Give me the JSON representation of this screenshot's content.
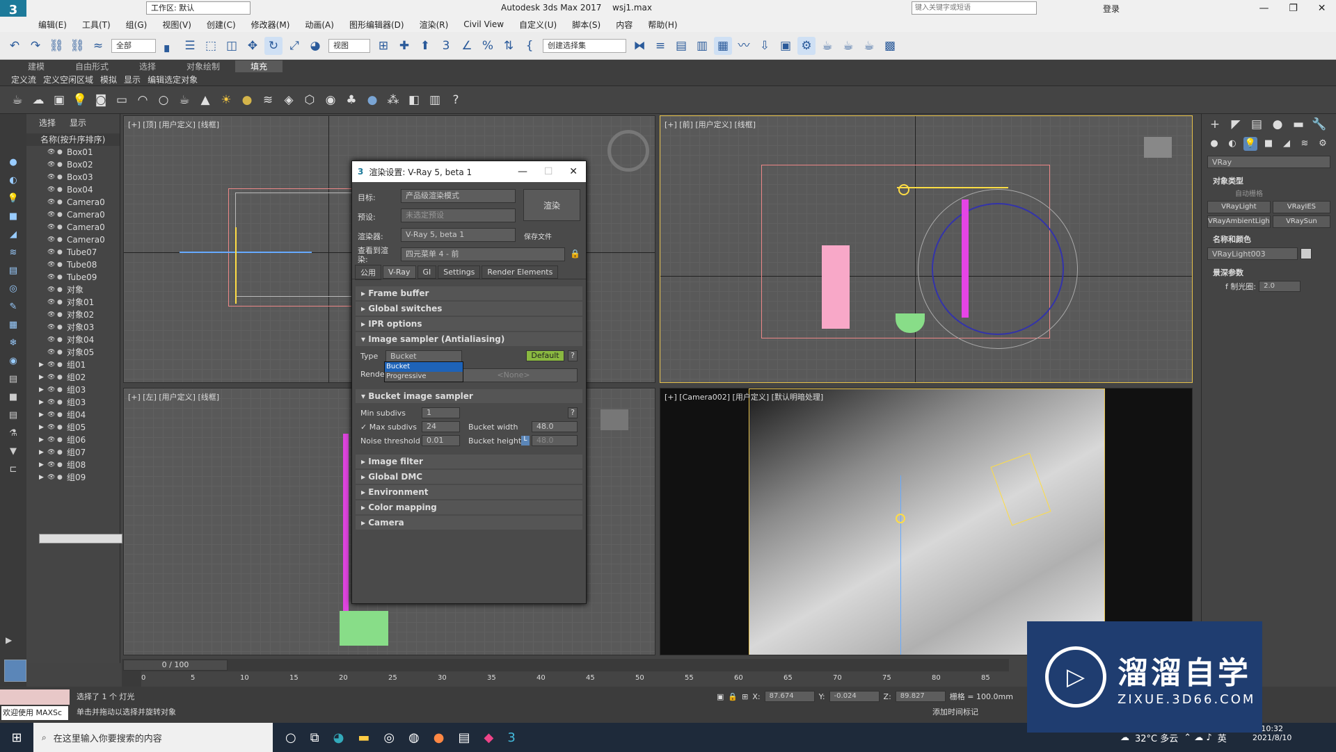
{
  "titlebar": {
    "workspace_label": "工作区: 默认",
    "app_title": "Autodesk 3ds Max 2017",
    "file_name": "wsj1.max",
    "search_placeholder": "键入关键字或短语",
    "login": "登录"
  },
  "menu": [
    "编辑(E)",
    "工具(T)",
    "组(G)",
    "视图(V)",
    "创建(C)",
    "修改器(M)",
    "动画(A)",
    "图形编辑器(D)",
    "渲染(R)",
    "Civil View",
    "自定义(U)",
    "脚本(S)",
    "内容",
    "帮助(H)"
  ],
  "toolbar": {
    "filter": "全部",
    "view": "视图",
    "selection_set": "创建选择集"
  },
  "ribbon": {
    "tabs": [
      "建模",
      "自由形式",
      "选择",
      "对象绘制",
      "填充"
    ],
    "active_tab": "填充",
    "sub": [
      "定义流",
      "定义空闲区域",
      "模拟",
      "显示",
      "编辑选定对象"
    ]
  },
  "scene": {
    "tabs": [
      "选择",
      "显示"
    ],
    "header": "名称(按升序排序)",
    "items": [
      "Box01",
      "Box02",
      "Box03",
      "Box04",
      "Camera0",
      "Camera0",
      "Camera0",
      "Camera0",
      "Tube07",
      "Tube08",
      "Tube09",
      "对象",
      "对象01",
      "对象02",
      "对象03",
      "对象04",
      "对象05",
      "组01",
      "组02",
      "组03",
      "组03",
      "组04",
      "组05",
      "组06",
      "组07",
      "组08",
      "组09"
    ]
  },
  "viewports": {
    "top": "[+] [顶] [用户定义] [线框]",
    "front": "[+] [前] [用户定义] [线框]",
    "left": "[+] [左] [用户定义] [线框]",
    "camera": "[+] [Camera002] [用户定义] [默认明暗处理]"
  },
  "dialog": {
    "title": "渲染设置: V-Ray 5, beta 1",
    "target_label": "目标:",
    "target_value": "产品级渲染模式",
    "preset_label": "预设:",
    "preset_value": "未选定预设",
    "renderer_label": "渲染器:",
    "renderer_value": "V-Ray 5, beta 1",
    "save_file": "保存文件",
    "view_label": "查看到渲染:",
    "view_value": "四元菜单 4 - 前",
    "render_button": "渲染",
    "tabs": [
      "公用",
      "V-Ray",
      "GI",
      "Settings",
      "Render Elements"
    ],
    "rollouts_top": [
      "Frame buffer",
      "Global switches",
      "IPR options",
      "Image sampler (Antialiasing)"
    ],
    "type_label": "Type",
    "type_value": "Bucket",
    "default_btn": "Default",
    "help": "?",
    "render_mask_label": "Render",
    "render_mask_value": "<None>",
    "dropdown": [
      "Bucket",
      "Progressive"
    ],
    "bucket_title": "Bucket image sampler",
    "min_subdivs_label": "Min subdivs",
    "min_subdivs": "1",
    "max_subdivs_label": "Max subdivs",
    "max_subdivs": "24",
    "noise_label": "Noise threshold",
    "noise": "0.01",
    "bucket_width_label": "Bucket width",
    "bucket_width": "48.0",
    "bucket_height_label": "Bucket height",
    "bucket_height": "48.0",
    "lock": "L",
    "rollouts_bottom": [
      "Image filter",
      "Global DMC",
      "Environment",
      "Color mapping",
      "Camera"
    ]
  },
  "rightpanel": {
    "renderer": "VRay",
    "object_type": "对象类型",
    "auto_grid": "自动栅格",
    "buttons": [
      "VRayLight",
      "VRayIES",
      "VRayAmbientLigh",
      "VRaySun"
    ],
    "name_color": "名称和颜色",
    "name_value": "VRayLight003",
    "sun_params": "景深参数",
    "f_label": "f 制光圈:",
    "f_value": "2.0"
  },
  "timeline": {
    "counter": "0 / 100",
    "ticks": [
      "0",
      "5",
      "10",
      "15",
      "20",
      "25",
      "30",
      "35",
      "40",
      "45",
      "50",
      "55",
      "60",
      "65",
      "70",
      "75",
      "80",
      "85"
    ]
  },
  "status": {
    "welcome": "欢迎使用 MAXSc",
    "selected": "选择了 1 个 灯光",
    "hint": "单击并拖动以选择并旋转对象",
    "x_label": "X:",
    "x": "87.674",
    "y_label": "Y:",
    "y": "-0.024",
    "z_label": "Z:",
    "z": "89.827",
    "grid": "栅格 = 100.0mm",
    "add_tag": "添加时间标记"
  },
  "taskbar": {
    "search": "在这里输入你要搜索的内容",
    "temp": "32°C 多云",
    "lang": "英",
    "time": "10:32",
    "date": "2021/8/10"
  },
  "watermark": {
    "brand": "溜溜自学",
    "url": "ZIXUE.3D66.COM"
  }
}
